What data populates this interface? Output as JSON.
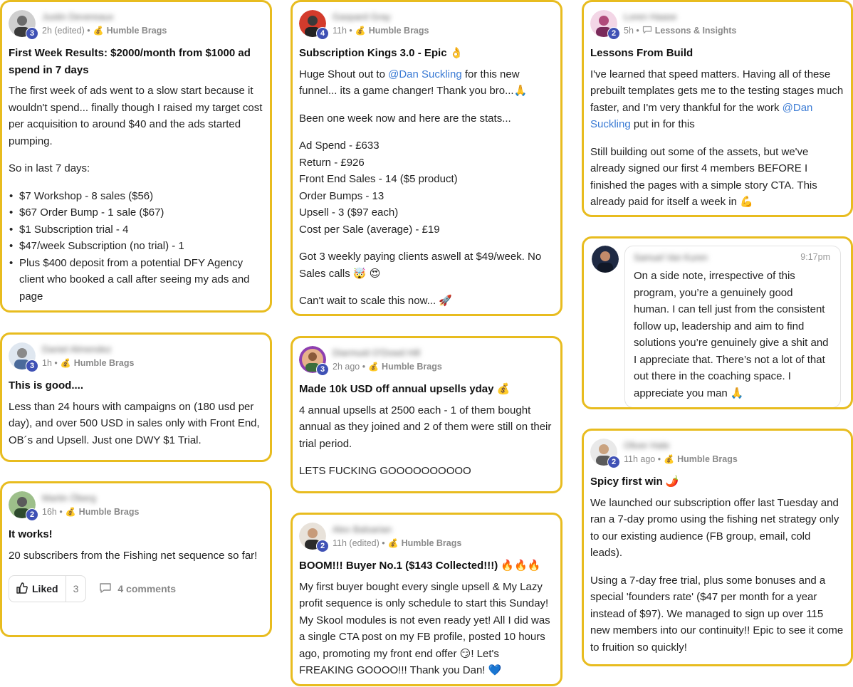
{
  "posts": [
    {
      "author": "Justin Devereaux",
      "level": "3",
      "meta": "2h (edited) •",
      "category": "Humble Brags",
      "title": "First Week Results: $2000/month from $1000 ad spend in 7 days",
      "p1": "The first week of ads went to a slow start because it wouldn't spend... finally though I raised my target cost per acquisition to around $40 and the ads started pumping.",
      "p2": "So in last 7 days:",
      "list": [
        "$7 Workshop - 8 sales ($56)",
        "$67 Order Bump - 1 sale ($67)",
        "$1 Subscription trial - 4",
        "$47/week Subscription (no trial) - 1",
        "Plus $400 deposit from a potential DFY Agency client who booked a call after seeing my ads and page"
      ]
    },
    {
      "author": "Daniel Almendez",
      "level": "3",
      "meta": "1h •",
      "category": "Humble Brags",
      "title": "This is good....",
      "p1": "Less than 24 hours with campaigns on (180 usd per day), and over 500 USD in sales only with Front End, OB´s and Upsell. Just one DWY $1 Trial."
    },
    {
      "author": "Martin Öberg",
      "level": "2",
      "meta": "16h •",
      "category": "Humble Brags",
      "title": "It works!",
      "p1": "20 subscribers from the Fishing net sequence so far!",
      "like_label": "Liked",
      "like_count": "3",
      "comments_label": "4 comments"
    },
    {
      "author": "Gaspard Gray",
      "level": "4",
      "meta": "11h •",
      "category": "Humble Brags",
      "title": "Subscription Kings 3.0 - Epic 👌",
      "p1_pre": "Huge Shout out to ",
      "mention": "@Dan Suckling",
      "p1_post": " for this new funnel... its a game changer! Thank you bro...🙏",
      "p2": "Been one week now and here are the stats...",
      "stats": [
        "Ad Spend - £633",
        "Return - £926",
        "Front End Sales - 14 ($5 product)",
        "Order Bumps - 13",
        "Upsell - 3 ($97 each)",
        "Cost per Sale (average) - £19"
      ],
      "p3": "Got 3 weekly paying clients aswell at $49/week. No Sales calls 🤯 😍",
      "p4": "Can't wait to scale this now... 🚀"
    },
    {
      "author": "Diarmuid O'Dowd Hill",
      "level": "3",
      "meta": "2h ago •",
      "category": "Humble Brags",
      "title": "Made 10k USD off annual upsells yday 💰",
      "p1": "4 annual upsells at 2500 each - 1 of them bought annual as they joined and 2 of them were still on their trial period.",
      "p2": "LETS FUCKING GOOOOOOOOOO"
    },
    {
      "author": "Alex Balsarian",
      "level": "2",
      "meta": "11h (edited) •",
      "category": "Humble Brags",
      "title": "BOOM!!! Buyer No.1 ($143 Collected!!!) 🔥🔥🔥",
      "p1": "My first buyer bought every single upsell & My Lazy profit sequence is only schedule to start this Sunday! My Skool modules is not even ready yet! All I did was a single CTA post on my FB profile, posted 10 hours ago, promoting my front end offer 😏! Let's FREAKING GOOOO!!! Thank you Dan! 💙"
    },
    {
      "author": "Loren Haase",
      "level": "2",
      "meta": "5h •",
      "category": "Lessons & Insights",
      "title": "Lessons From Build",
      "p1_pre": "I've learned that speed matters. Having all of these prebuilt templates gets me to the testing stages much faster, and I'm very thankful for the work ",
      "mention": "@Dan Suckling",
      "p1_post": " put in for this",
      "p2": "Still building out some of the assets, but we've already signed our first 4 members BEFORE I finished the pages with a simple story CTA. This already paid for itself a week in 💪"
    },
    {
      "author": "Samuel Van Kuren",
      "time": "9:17pm",
      "p1": "On a side note, irrespective of this program, you’re a genuinely good human. I can tell just from the consistent follow up, leadership and aim to find solutions you’re genuinely give a shit and I appreciate that. There’s not a lot of that out there in the coaching space. I appreciate you man 🙏"
    },
    {
      "author": "Oliver Hale",
      "level": "2",
      "meta": "11h ago •",
      "category": "Humble Brags",
      "title": "Spicy first win 🌶️",
      "p1": "We launched our subscription offer last Tuesday and ran a 7-day promo using the fishing net strategy only to our existing audience (FB group, email, cold leads).",
      "p2": "Using a 7-day free trial, plus some bonuses and a special 'founders rate' ($47 per month for a year instead of $97). We managed to sign up over 115 new members into our continuity!! Epic to see it come to fruition so quickly!"
    }
  ],
  "colors": {
    "border": "#e8bc1f",
    "level_badge": "#3f51b5",
    "mention": "#3b7bd4"
  },
  "icons": {
    "category": "money-bag-icon",
    "lessons": "speech-bubble-icon",
    "like": "thumbs-up-icon",
    "comment": "comment-icon"
  }
}
